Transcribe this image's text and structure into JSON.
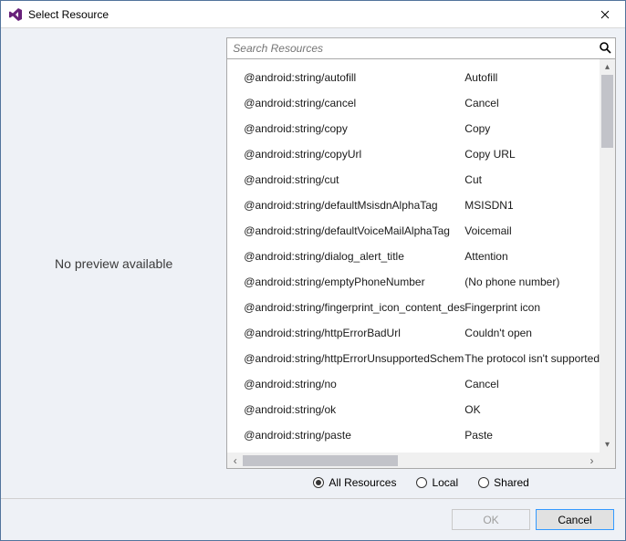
{
  "window": {
    "title": "Select Resource"
  },
  "preview": {
    "message": "No preview available"
  },
  "search": {
    "placeholder": "Search Resources"
  },
  "resources": [
    {
      "key": "@android:string/autofill",
      "value": "Autofill"
    },
    {
      "key": "@android:string/cancel",
      "value": "Cancel"
    },
    {
      "key": "@android:string/copy",
      "value": "Copy"
    },
    {
      "key": "@android:string/copyUrl",
      "value": "Copy URL"
    },
    {
      "key": "@android:string/cut",
      "value": "Cut"
    },
    {
      "key": "@android:string/defaultMsisdnAlphaTag",
      "value": "MSISDN1"
    },
    {
      "key": "@android:string/defaultVoiceMailAlphaTag",
      "value": "Voicemail"
    },
    {
      "key": "@android:string/dialog_alert_title",
      "value": "Attention"
    },
    {
      "key": "@android:string/emptyPhoneNumber",
      "value": "(No phone number)"
    },
    {
      "key": "@android:string/fingerprint_icon_content_description",
      "value": "Fingerprint icon"
    },
    {
      "key": "@android:string/httpErrorBadUrl",
      "value": "Couldn't open"
    },
    {
      "key": "@android:string/httpErrorUnsupportedScheme",
      "value": "The protocol isn't supported"
    },
    {
      "key": "@android:string/no",
      "value": "Cancel"
    },
    {
      "key": "@android:string/ok",
      "value": "OK"
    },
    {
      "key": "@android:string/paste",
      "value": "Paste"
    }
  ],
  "filters": {
    "all": "All Resources",
    "local": "Local",
    "shared": "Shared",
    "selected": "all"
  },
  "footer": {
    "ok": "OK",
    "cancel": "Cancel"
  }
}
